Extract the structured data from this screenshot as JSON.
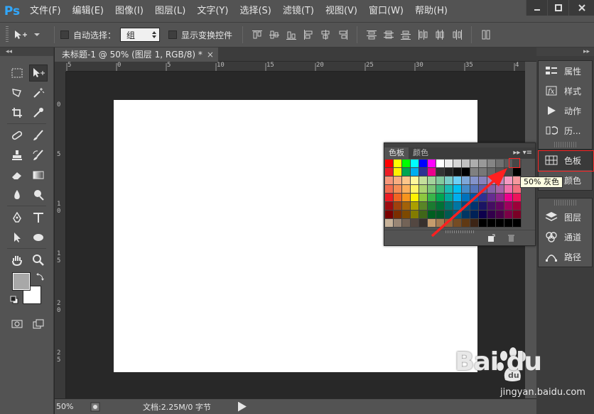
{
  "app": {
    "logo": "Ps",
    "menu": [
      "文件(F)",
      "编辑(E)",
      "图像(I)",
      "图层(L)",
      "文字(Y)",
      "选择(S)",
      "滤镜(T)",
      "视图(V)",
      "窗口(W)",
      "帮助(H)"
    ]
  },
  "options": {
    "auto_select_label": "自动选择：",
    "group_value": "组",
    "show_transform_label": "显示变换控件"
  },
  "document": {
    "tab_title": "未标题-1 @ 50% (图层 1, RGB/8) *",
    "close_glyph": "×",
    "zoom": "50%",
    "doc_info": "文档:2.25M/0 字节",
    "ruler_top_labels": [
      "5",
      "0",
      "5",
      "10",
      "15",
      "20",
      "25",
      "30",
      "35",
      "4"
    ],
    "ruler_left_labels": [
      "0",
      "5",
      "1 0",
      "1 5",
      "2 0",
      "2 5"
    ]
  },
  "dock": {
    "group1": [
      "属性",
      "样式",
      "动作",
      "历..."
    ],
    "group2": [
      "色板",
      "颜色"
    ],
    "group3": [
      "图层",
      "通道",
      "路径"
    ]
  },
  "swatches": {
    "tabs": [
      "色板",
      "颜色"
    ],
    "tooltip": "50% 灰色",
    "rows": [
      [
        "#ff0000",
        "#ffff00",
        "#00ff00",
        "#00ffff",
        "#0000ff",
        "#ff00ff",
        "#ffffff",
        "#ebebeb",
        "#d6d6d6",
        "#c2c2c2",
        "#adadad",
        "#999999",
        "#858585",
        "#707070",
        "#5c5c5c",
        "#474747"
      ],
      [
        "#ed1c24",
        "#fff200",
        "#00a651",
        "#00aeef",
        "#2e3192",
        "#ec008c",
        "#333333",
        "#222222",
        "#111111",
        "#000000",
        "#808080",
        "#777777",
        "#666666",
        "#555555",
        "#444444",
        "#000000"
      ],
      [
        "#f7977a",
        "#f9ad81",
        "#fdc68a",
        "#fff79a",
        "#c4df9b",
        "#a3d39c",
        "#82ca9d",
        "#7bcdc8",
        "#6ecff6",
        "#7ea7d8",
        "#8493ca",
        "#8882be",
        "#a187be",
        "#bc8dbf",
        "#f49ac2",
        "#f6989d"
      ],
      [
        "#f26c4f",
        "#f68e55",
        "#fbaf5c",
        "#fff467",
        "#acd372",
        "#7cc576",
        "#3bb878",
        "#1abbb4",
        "#00bff3",
        "#438cca",
        "#5574b9",
        "#605ca8",
        "#855fa8",
        "#a763a8",
        "#f06eaa",
        "#f26d7d"
      ],
      [
        "#ed1c24",
        "#f26522",
        "#f7941d",
        "#fff200",
        "#8dc73f",
        "#39b54a",
        "#00a651",
        "#00a99d",
        "#00aeef",
        "#0072bc",
        "#0054a6",
        "#2e3192",
        "#662d91",
        "#92278f",
        "#ec008c",
        "#ed145b"
      ],
      [
        "#9e0b0f",
        "#a0410d",
        "#a36209",
        "#aba000",
        "#598527",
        "#1a7b30",
        "#007236",
        "#00746b",
        "#0076a3",
        "#004b80",
        "#003471",
        "#1b1464",
        "#440e62",
        "#630460",
        "#9e005d",
        "#9e0039"
      ],
      [
        "#790000",
        "#7b2e00",
        "#7d4900",
        "#827b00",
        "#406618",
        "#005e20",
        "#005826",
        "#005952",
        "#005b7f",
        "#003663",
        "#002157",
        "#0d004c",
        "#32004b",
        "#4b0049",
        "#7b0046",
        "#7a0026"
      ],
      [
        "#c7b299",
        "#998675",
        "#736357",
        "#534741",
        "#37302d",
        "#c69c6d",
        "#a67c52",
        "#8c6239",
        "#754c24",
        "#603913",
        "#3c2415",
        "#000000",
        "#000000",
        "#000000",
        "#000000",
        "#000000"
      ]
    ]
  },
  "watermark": {
    "text": "Bai du",
    "url": "jingyan.baidu.com"
  }
}
